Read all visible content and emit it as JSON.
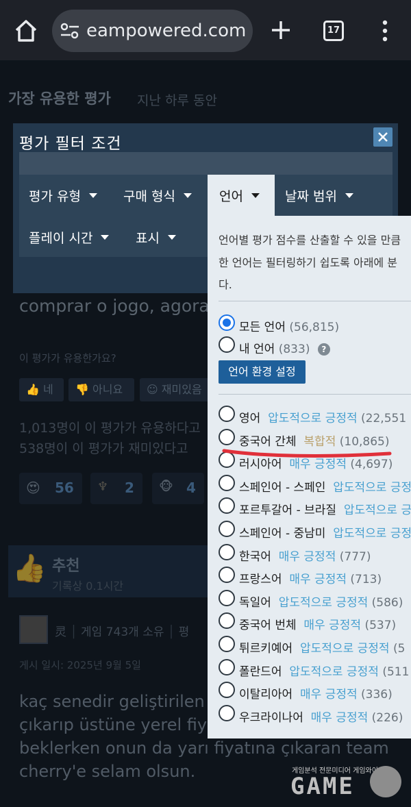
{
  "browser": {
    "url": "eampowered.com",
    "tab_count": "17"
  },
  "page": {
    "section_title": "가장 유용한 평가",
    "section_subtitle": "지난 하루 동안",
    "review_snippet": "comprar o jogo, agora é",
    "helpful_question": "이 평가가 유용한가요?",
    "vote_yes": "네",
    "vote_no": "아니요",
    "vote_funny": "재미있음",
    "helpful_count_text": "1,013명이 이 평가가 유용하다고",
    "funny_count_text": "538명이 이 평가가 재미있다고",
    "award_1_count": "56",
    "award_2_count": "2",
    "award_3_count": "4",
    "recommend_label": "추천",
    "playtime_text": "기록상 0.1시간",
    "username": "灵",
    "user_games": "게임 743개 소유",
    "user_tail": "평",
    "posted_date": "게시 일시: 2025년 9월 5일",
    "review_lines": [
      "kaç senedir geliştirilen o",
      "çıkarıp üstüne yerel fiya",
      "beklerken onun da yarı fiyatına çıkaran team",
      "cherry'e selam olsun."
    ]
  },
  "modal": {
    "title": "평가 필터 조건",
    "tabs": {
      "review_type": "평가 유형",
      "purchase_type": "구매 형식",
      "language": "언어",
      "date_range": "날짜 범위",
      "playtime": "플레이 시간",
      "display": "표시"
    }
  },
  "language_dropdown": {
    "description_lines": [
      "언어별 평가 점수를 산출할 수 있을 만큼",
      "한 언어는 필터링하기 쉽도록 아래에 분",
      "다."
    ],
    "all_languages": {
      "label": "모든 언어",
      "count": "(56,815)"
    },
    "my_languages": {
      "label": "내 언어",
      "count": "(833)"
    },
    "settings_button": "언어 환경 설정",
    "languages": [
      {
        "name": "영어",
        "rating": "압도적으로 긍정적",
        "count": "(22,551",
        "rating_type": "positive"
      },
      {
        "name": "중국어 간체",
        "rating": "복합적",
        "count": "(10,865)",
        "rating_type": "mixed"
      },
      {
        "name": "러시아어",
        "rating": "매우 긍정적",
        "count": "(4,697)",
        "rating_type": "positive"
      },
      {
        "name": "스페인어 - 스페인",
        "rating": "압도적으로 긍정",
        "count": "",
        "rating_type": "positive"
      },
      {
        "name": "포르투갈어 - 브라질",
        "rating": "압도적으로 긍",
        "count": "",
        "rating_type": "positive"
      },
      {
        "name": "스페인어 - 중남미",
        "rating": "압도적으로 긍정",
        "count": "",
        "rating_type": "positive"
      },
      {
        "name": "한국어",
        "rating": "매우 긍정적",
        "count": "(777)",
        "rating_type": "positive"
      },
      {
        "name": "프랑스어",
        "rating": "매우 긍정적",
        "count": "(713)",
        "rating_type": "positive"
      },
      {
        "name": "독일어",
        "rating": "압도적으로 긍정적",
        "count": "(586)",
        "rating_type": "positive"
      },
      {
        "name": "중국어 번체",
        "rating": "매우 긍정적",
        "count": "(537)",
        "rating_type": "positive"
      },
      {
        "name": "튀르키예어",
        "rating": "압도적으로 긍정적",
        "count": "(5",
        "rating_type": "positive"
      },
      {
        "name": "폴란드어",
        "rating": "압도적으로 긍정적",
        "count": "(511",
        "rating_type": "positive"
      },
      {
        "name": "이탈리아어",
        "rating": "매우 긍정적",
        "count": "(336)",
        "rating_type": "positive"
      },
      {
        "name": "우크라이나어",
        "rating": "매우 긍정적",
        "count": "(226)",
        "rating_type": "positive"
      }
    ]
  },
  "watermark": {
    "tagline": "게임분석 전문미디어 게임와이",
    "logo": "GAME"
  },
  "colors": {
    "positive": "#48a0d0",
    "mixed": "#b9a06a",
    "annotation": "#e0303a"
  }
}
